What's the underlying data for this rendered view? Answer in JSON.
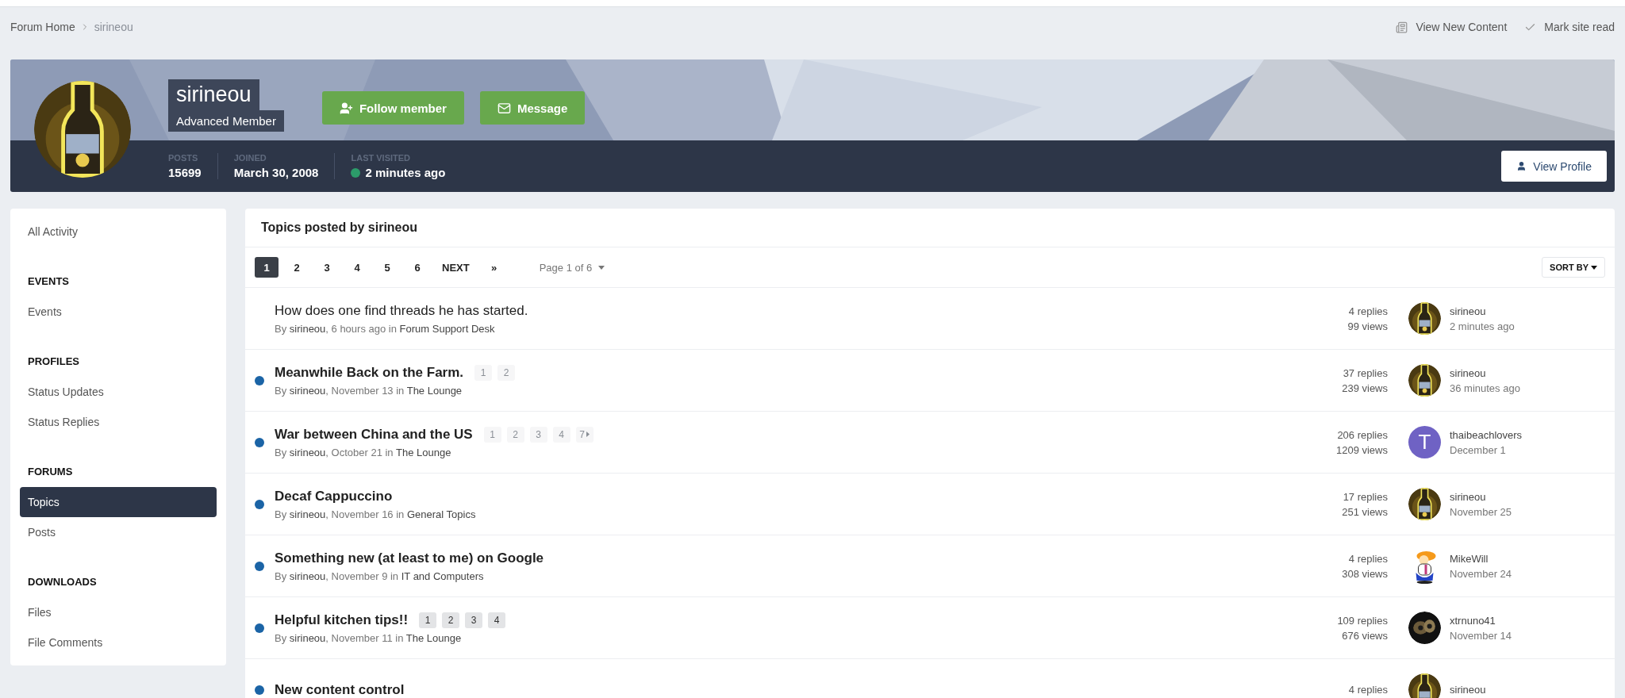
{
  "breadcrumb": [
    {
      "label": "Forum Home"
    },
    {
      "label": "sirineou"
    }
  ],
  "header_links": [
    {
      "kind": "news",
      "label": "View New Content"
    },
    {
      "kind": "check",
      "label": "Mark site read"
    }
  ],
  "profile": {
    "name": "sirineou",
    "rank": "Advanced Member",
    "buttons": [
      {
        "kind": "follow",
        "label": "Follow member"
      },
      {
        "kind": "message",
        "label": "Message"
      }
    ],
    "stats": [
      {
        "label": "POSTS",
        "value": "15699",
        "online": false
      },
      {
        "label": "JOINED",
        "value": "March 30, 2008",
        "online": false
      },
      {
        "label": "LAST VISITED",
        "value": "2 minutes ago",
        "online": true
      }
    ],
    "view_profile": "View Profile"
  },
  "sidebar": {
    "items": [
      {
        "kind": "link",
        "label": "All Activity",
        "selected": false
      },
      {
        "kind": "heading",
        "label": "EVENTS"
      },
      {
        "kind": "link",
        "label": "Events",
        "selected": false
      },
      {
        "kind": "heading",
        "label": "PROFILES"
      },
      {
        "kind": "link",
        "label": "Status Updates",
        "selected": false
      },
      {
        "kind": "link",
        "label": "Status Replies",
        "selected": false
      },
      {
        "kind": "heading",
        "label": "FORUMS"
      },
      {
        "kind": "link",
        "label": "Topics",
        "selected": true
      },
      {
        "kind": "link",
        "label": "Posts",
        "selected": false
      },
      {
        "kind": "heading",
        "label": "DOWNLOADS"
      },
      {
        "kind": "link",
        "label": "Files",
        "selected": false
      },
      {
        "kind": "link",
        "label": "File Comments",
        "selected": false
      }
    ]
  },
  "topics": {
    "title": "Topics posted by sirineou",
    "pagination": {
      "pages": [
        {
          "label": "1",
          "selected": true
        },
        {
          "label": "2",
          "selected": false
        },
        {
          "label": "3",
          "selected": false
        },
        {
          "label": "4",
          "selected": false
        },
        {
          "label": "5",
          "selected": false
        },
        {
          "label": "6",
          "selected": false
        }
      ],
      "next": "NEXT",
      "last": "»",
      "page_of": "Page 1 of 6"
    },
    "sort": "SORT BY",
    "rows": [
      {
        "title": "How does one find threads he has started.",
        "unread": false,
        "meta": {
          "prefix": "By ",
          "author": "sirineou",
          "middle": ", 6 hours ago in ",
          "forum": "Forum Support Desk"
        },
        "replies": "4 replies",
        "views": "99 views",
        "last_poster": "sirineou",
        "last_date": "2 minutes ago",
        "avatar": {
          "kind": "bottle"
        }
      },
      {
        "title": "Meanwhile Back on the Farm.",
        "unread": true,
        "pages": [
          "1",
          "2"
        ],
        "pages_faded": true,
        "pages_more": false,
        "meta": {
          "prefix": "By ",
          "author": "sirineou",
          "middle": ", November 13 in ",
          "forum": "The Lounge"
        },
        "replies": "37 replies",
        "views": "239 views",
        "last_poster": "sirineou",
        "last_date": "36 minutes ago",
        "avatar": {
          "kind": "bottle"
        }
      },
      {
        "title": "War between China and the US",
        "unread": true,
        "pages": [
          "1",
          "2",
          "3",
          "4",
          "7"
        ],
        "pages_faded": true,
        "pages_more": true,
        "meta": {
          "prefix": "By ",
          "author": "sirineou",
          "middle": ", October 21 in ",
          "forum": "The Lounge"
        },
        "replies": "206 replies",
        "views": "1209 views",
        "last_poster": "thaibeachlovers",
        "last_date": "December 1",
        "avatar": {
          "kind": "letter",
          "letter": "T",
          "color": "#6f62c4"
        }
      },
      {
        "title": "Decaf Cappuccino",
        "unread": true,
        "meta": {
          "prefix": "By ",
          "author": "sirineou",
          "middle": ", November 16 in ",
          "forum": "General Topics"
        },
        "replies": "17 replies",
        "views": "251 views",
        "last_poster": "sirineou",
        "last_date": "November 25",
        "avatar": {
          "kind": "bottle"
        }
      },
      {
        "title": "Something new (at least to me) on Google",
        "unread": true,
        "meta": {
          "prefix": "By ",
          "author": "sirineou",
          "middle": ", November 9 in ",
          "forum": "IT and Computers"
        },
        "replies": "4 replies",
        "views": "308 views",
        "last_poster": "MikeWill",
        "last_date": "November 24",
        "avatar": {
          "kind": "cartoon"
        }
      },
      {
        "title": "Helpful kitchen tips!!",
        "unread": true,
        "pages": [
          "1",
          "2",
          "3",
          "4"
        ],
        "pages_faded": false,
        "pages_more": false,
        "meta": {
          "prefix": "By ",
          "author": "sirineou",
          "middle": ", November 11 in ",
          "forum": "The Lounge"
        },
        "replies": "109 replies",
        "views": "676 views",
        "last_poster": "xtrnuno41",
        "last_date": "November 14",
        "avatar": {
          "kind": "dark"
        }
      },
      {
        "title": "New content control",
        "unread": true,
        "replies": "4 replies",
        "last_poster": "sirineou",
        "avatar": {
          "kind": "bottle"
        }
      }
    ]
  }
}
